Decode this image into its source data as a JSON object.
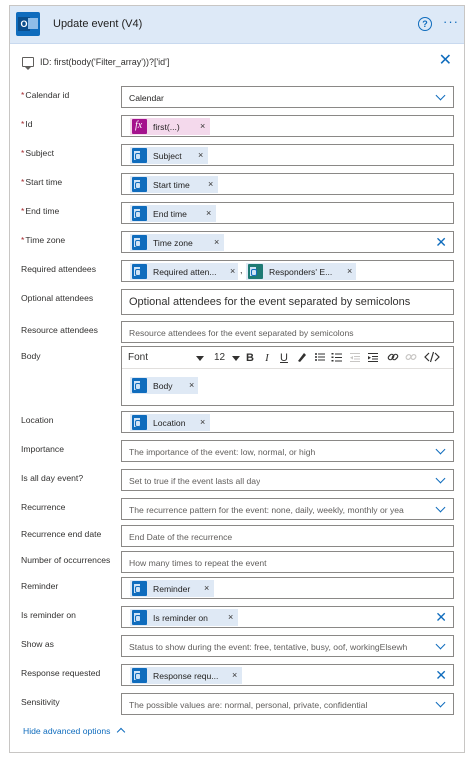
{
  "header": {
    "title": "Update event (V4)"
  },
  "id_row": {
    "text": "ID: first(body('Filter_array'))?['id']"
  },
  "fields": {
    "calendar_id": {
      "label": "Calendar id",
      "value": "Calendar"
    },
    "id": {
      "label": "Id",
      "token": "first(...)"
    },
    "subject": {
      "label": "Subject",
      "token": "Subject"
    },
    "start_time": {
      "label": "Start time",
      "token": "Start time"
    },
    "end_time": {
      "label": "End time",
      "token": "End time"
    },
    "time_zone": {
      "label": "Time zone",
      "token": "Time zone"
    },
    "required_attendees": {
      "label": "Required attendees",
      "token1": "Required atten...",
      "token2": "Responders' E..."
    },
    "optional_attendees": {
      "label": "Optional attendees",
      "placeholder": "Optional attendees for the event separated by semicolons"
    },
    "resource_attendees": {
      "label": "Resource attendees",
      "placeholder": "Resource attendees for the event separated by semicolons"
    },
    "body": {
      "label": "Body",
      "font": "Font",
      "size": "12",
      "token": "Body"
    },
    "location": {
      "label": "Location",
      "token": "Location"
    },
    "importance": {
      "label": "Importance",
      "placeholder": "The importance of the event: low, normal, or high"
    },
    "is_all_day": {
      "label": "Is all day event?",
      "placeholder": "Set to true if the event lasts all day"
    },
    "recurrence": {
      "label": "Recurrence",
      "placeholder": "The recurrence pattern for the event: none, daily, weekly, monthly or yea"
    },
    "recurrence_end": {
      "label": "Recurrence end date",
      "placeholder": "End Date of the recurrence"
    },
    "occurrences": {
      "label": "Number of occurrences",
      "placeholder": "How many times to repeat the event"
    },
    "reminder": {
      "label": "Reminder",
      "token": "Reminder"
    },
    "is_reminder_on": {
      "label": "Is reminder on",
      "token": "Is reminder on"
    },
    "show_as": {
      "label": "Show as",
      "placeholder": "Status to show during the event: free, tentative, busy, oof, workingElsewh"
    },
    "response_requested": {
      "label": "Response requested",
      "token": "Response requ..."
    },
    "sensitivity": {
      "label": "Sensitivity",
      "placeholder": "The possible values are: normal, personal, private, confidential"
    }
  },
  "footer": {
    "hide_advanced": "Hide advanced options"
  },
  "symbols": {
    "required_mark": "*",
    "remove": "×",
    "comma": ",",
    "help": "?",
    "more": "···",
    "close": "✕",
    "fx": "fx"
  },
  "toolbar_glyphs": {
    "bold": "B",
    "italic": "I",
    "underline": "U"
  },
  "colors": {
    "accent": "#0f6cbd",
    "header_bg": "#dde9f7",
    "token_bg": "#dfe9f5",
    "fx_token_bg": "#f4d9ec",
    "required": "#a4262c"
  }
}
